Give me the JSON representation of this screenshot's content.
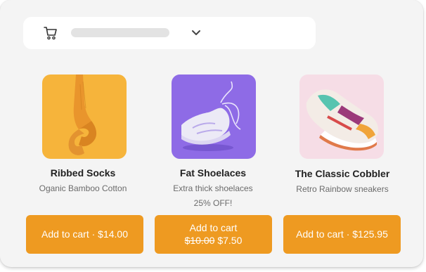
{
  "header": {
    "cart_icon": "shopping-cart-icon",
    "dropdown_icon": "chevron-down-icon"
  },
  "products": [
    {
      "name": "Ribbed Socks",
      "description": "Oganic Bamboo Cotton",
      "button": {
        "label": "Add to cart · $14.00"
      },
      "image_background": "#f6b43b"
    },
    {
      "name": "Fat Shoelaces",
      "description": "Extra thick shoelaces",
      "promo": "25% OFF!",
      "button": {
        "label": "Add to cart",
        "old_price": "$10.00",
        "new_price": "$7.50"
      },
      "image_background": "#8e6be6"
    },
    {
      "name": "The Classic Cobbler",
      "description": "Retro Rainbow sneakers",
      "button": {
        "label": "Add to cart · $125.95"
      },
      "image_background": "#f6dde6"
    }
  ],
  "colors": {
    "accent": "#ee9a21",
    "card_background": "#f4f4f4",
    "button_text": "#ffffff"
  }
}
